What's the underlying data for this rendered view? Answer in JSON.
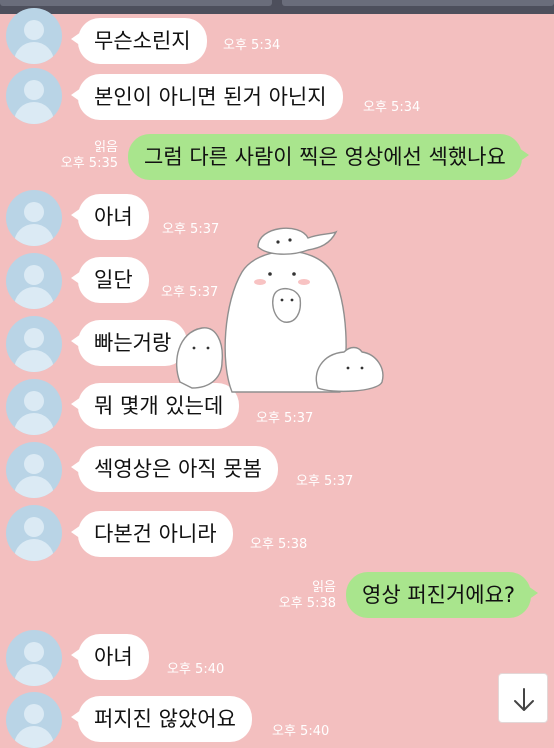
{
  "colors": {
    "background": "#f3bfbf",
    "incoming_bubble": "#ffffff",
    "outgoing_bubble": "#a9e58d",
    "meta_text": "#ffffff"
  },
  "messages": [
    {
      "side": "in",
      "text": "무슨소린지",
      "time": "오후 5:34",
      "avatar": true
    },
    {
      "side": "in",
      "text": "본인이 아니면 된거 아닌지",
      "time": "오후 5:34",
      "avatar": true
    },
    {
      "side": "out",
      "text": "그럼 다른 사람이 찍은 영상에선 섹했나요",
      "time": "오후 5:35",
      "read": "읽음"
    },
    {
      "side": "in",
      "text": "아녀",
      "time": "오후 5:37",
      "avatar": true
    },
    {
      "side": "in",
      "text": "일단",
      "time": "오후 5:37",
      "avatar": true
    },
    {
      "side": "in",
      "text": "빠는거랑",
      "time": "",
      "avatar": true
    },
    {
      "side": "in",
      "text": "뭐 몇개 있는데",
      "time": "오후 5:37",
      "avatar": true
    },
    {
      "side": "in",
      "text": "섹영상은 아직 못봄",
      "time": "오후 5:37",
      "avatar": true
    },
    {
      "side": "in",
      "text": "다본건 아니라",
      "time": "오후 5:38",
      "avatar": true
    },
    {
      "side": "out",
      "text": "영상 퍼진거에요?",
      "time": "오후 5:38",
      "read": "읽음"
    },
    {
      "side": "in",
      "text": "아녀",
      "time": "오후 5:40",
      "avatar": true
    },
    {
      "side": "in",
      "text": "퍼지진 않았어요",
      "time": "오후 5:40",
      "avatar": true
    }
  ],
  "sticker": {
    "icon": "ghost-cat-hamster-sticker"
  },
  "scroll_button": {
    "icon": "arrow-down-icon"
  }
}
